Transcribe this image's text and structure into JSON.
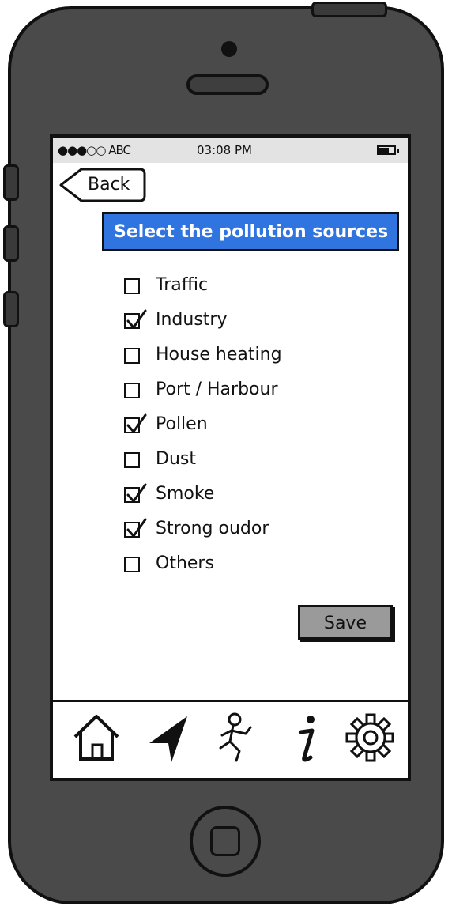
{
  "status_bar": {
    "carrier": "●●●○○ ABC",
    "time": "03:08 PM"
  },
  "back": {
    "label": "Back"
  },
  "title": "Select the pollution sources",
  "options": [
    {
      "label": "Traffic",
      "checked": false
    },
    {
      "label": "Industry",
      "checked": true
    },
    {
      "label": "House heating",
      "checked": false
    },
    {
      "label": "Port / Harbour",
      "checked": false
    },
    {
      "label": "Pollen",
      "checked": true
    },
    {
      "label": "Dust",
      "checked": false
    },
    {
      "label": "Smoke",
      "checked": true
    },
    {
      "label": "Strong oudor",
      "checked": true
    },
    {
      "label": "Others",
      "checked": false
    }
  ],
  "save": {
    "label": "Save"
  },
  "tabs": [
    "home-icon",
    "navigation-arrow-icon",
    "running-person-icon",
    "info-icon",
    "gear-icon"
  ],
  "colors": {
    "title_bar": "#2f74df",
    "phone_body": "#4a4a4a",
    "save_button": "#9a9a9a"
  }
}
